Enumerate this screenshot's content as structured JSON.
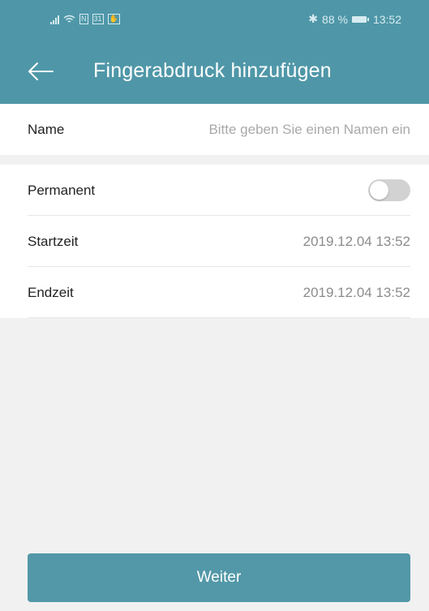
{
  "status_bar": {
    "mini_icon_1": "31",
    "battery_percent": "88 %",
    "time": "13:52",
    "icons": [
      "signal-icon",
      "wifi-icon",
      "nfc-icon",
      "calendar-icon",
      "app-notification-icon",
      "bluetooth-icon",
      "battery-icon"
    ]
  },
  "header": {
    "title": "Fingerabdruck hinzufügen",
    "back_icon": "arrow-left-icon"
  },
  "form": {
    "name_label": "Name",
    "name_placeholder": "Bitte geben Sie einen Namen ein",
    "name_value": "",
    "permanent_label": "Permanent",
    "permanent_enabled": false,
    "start_label": "Startzeit",
    "start_value": "2019.12.04 13:52",
    "end_label": "Endzeit",
    "end_value": "2019.12.04 13:52"
  },
  "footer": {
    "next_label": "Weiter"
  },
  "colors": {
    "primary": "#4f97a8",
    "button": "#5298a8",
    "background": "#f1f1f1",
    "toggle_off": "#d2d2d2"
  }
}
